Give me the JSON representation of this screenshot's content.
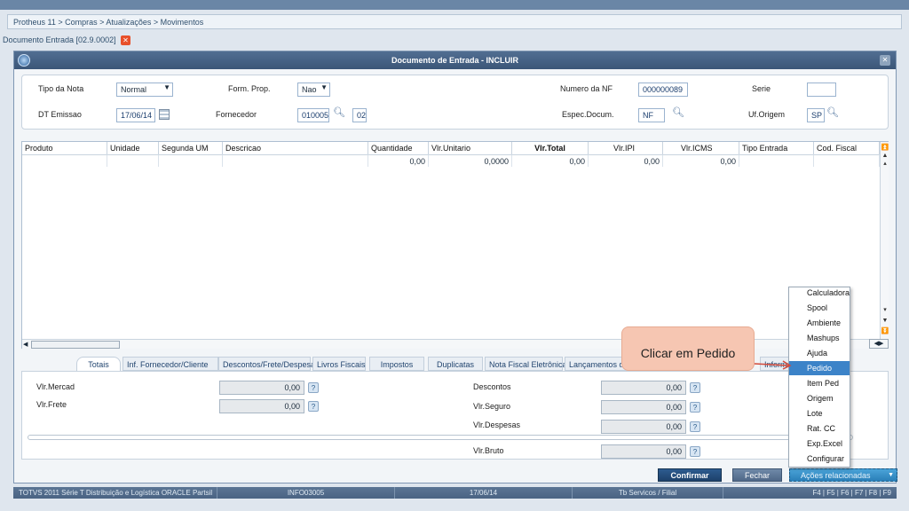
{
  "breadcrumb": "Protheus 11 > Compras > Atualizações > Movimentos",
  "doc_tab": "Documento Entrada [02.9.0002]",
  "doc_tab_close": "✕",
  "window": {
    "title": "Documento de Entrada - INCLUIR",
    "close": "✕"
  },
  "form": {
    "tipo_nota_label": "Tipo da Nota",
    "tipo_nota_value": "Normal",
    "form_prop_label": "Form. Prop.",
    "form_prop_value": "Nao",
    "numero_nf_label": "Numero da NF",
    "numero_nf_value": "000000089",
    "serie_label": "Serie",
    "serie_value": "",
    "dt_emissao_label": "DT Emissao",
    "dt_emissao_value": "17/06/14",
    "fornecedor_label": "Fornecedor",
    "fornecedor_value": "010005",
    "loja_value": "02",
    "espec_label": "Espec.Docum.",
    "espec_value": "NF",
    "uf_label": "Uf.Origem",
    "uf_value": "SP"
  },
  "grid": {
    "headers": [
      "Produto",
      "Unidade",
      "Segunda UM",
      "Descricao",
      "Quantidade",
      "Vlr.Unitario",
      "Vlr.Total",
      "Vlr.IPI",
      "Vlr.ICMS",
      "Tipo Entrada",
      "Cod. Fiscal"
    ],
    "row": [
      "",
      "",
      "",
      "",
      "0,00",
      "0,0000",
      "0,00",
      "0,00",
      "0,00",
      "",
      ""
    ]
  },
  "tabs": [
    "Totais",
    "Inf. Fornecedor/Cliente",
    "Descontos/Frete/Despesas",
    "Livros Fiscais",
    "Impostos",
    "Duplicatas",
    "Nota Fiscal Eletrônica",
    "Lançamentos da A",
    "Informações"
  ],
  "totais": {
    "vlr_mercad_label": "Vlr.Mercad",
    "vlr_mercad": "0,00",
    "vlr_frete_label": "Vlr.Frete",
    "vlr_frete": "0,00",
    "descontos_label": "Descontos",
    "descontos": "0,00",
    "vlr_seguro_label": "Vlr.Seguro",
    "vlr_seguro": "0,00",
    "vlr_despesas_label": "Vlr.Despesas",
    "vlr_despesas": "0,00",
    "vlr_bruto_label": "Vlr.Bruto",
    "vlr_bruto": "0,00",
    "help": "?"
  },
  "buttons": {
    "confirmar": "Confirmar",
    "fechar": "Fechar",
    "acoes": "Ações relacionadas"
  },
  "menu": [
    "Calculadora",
    "Spool",
    "Ambiente",
    "Mashups",
    "Ajuda",
    "Pedido",
    "Item Ped",
    "Origem",
    "Lote",
    "Rat. CC",
    "Exp.Excel",
    "Configurar"
  ],
  "callout": "Clicar em Pedido",
  "status": [
    "TOTVS 2011 Série T Distribuição e Logística ORACLE Partsil",
    "INFO03005",
    "17/06/14",
    "Tb Servicos / Filial",
    "F4 | F5 | F6 | F7 | F8 | F9"
  ],
  "colors": {
    "accent": "#3c83c8",
    "title": "#3b5678",
    "callout": "#f6c6b2"
  }
}
